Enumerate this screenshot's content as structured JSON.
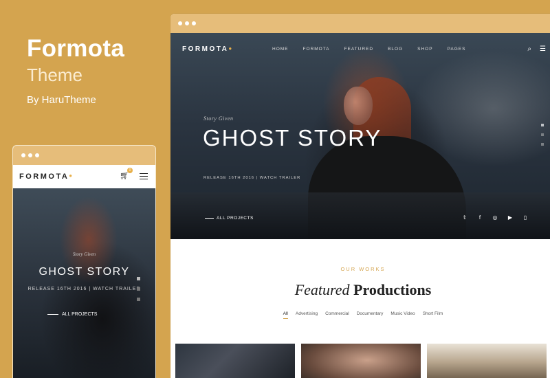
{
  "promo": {
    "title": "Formota",
    "subtitle": "Theme",
    "byline": "By HaruTheme"
  },
  "desktop": {
    "logo": "FORMOTA",
    "menu": [
      "HOME",
      "FORMOTA",
      "FEATURED",
      "BLOG",
      "SHOP",
      "PAGES"
    ],
    "icons": [
      "search-icon",
      "menu-icon"
    ],
    "hero": {
      "kicker": "Story Given",
      "title": "GHOST STORY",
      "meta": "RELEASE 16TH 2016  |  WATCH TRAILER",
      "all_projects": "ALL PROJECTS",
      "socials": [
        "twitter-icon",
        "facebook-icon",
        "instagram-icon",
        "youtube-icon",
        "vimeo-icon"
      ]
    },
    "works": {
      "kicker": "OUR WORKS",
      "title_italic": "Featured",
      "title_bold": "Productions",
      "filters": [
        "All",
        "Advertising",
        "Commercial",
        "Documentary",
        "Music Video",
        "Short Film"
      ],
      "active_filter": "All"
    }
  },
  "mobile": {
    "logo": "FORMOTA",
    "cart_count": "0",
    "hero": {
      "kicker": "Story Given",
      "title": "GHOST STORY",
      "meta": "RELEASE 16TH 2016  |  WATCH TRAILER",
      "all_projects": "ALL PROJECTS"
    }
  },
  "colors": {
    "background": "#d4a44f",
    "chrome": "#e6bd7a",
    "accent": "#e8b04a"
  }
}
